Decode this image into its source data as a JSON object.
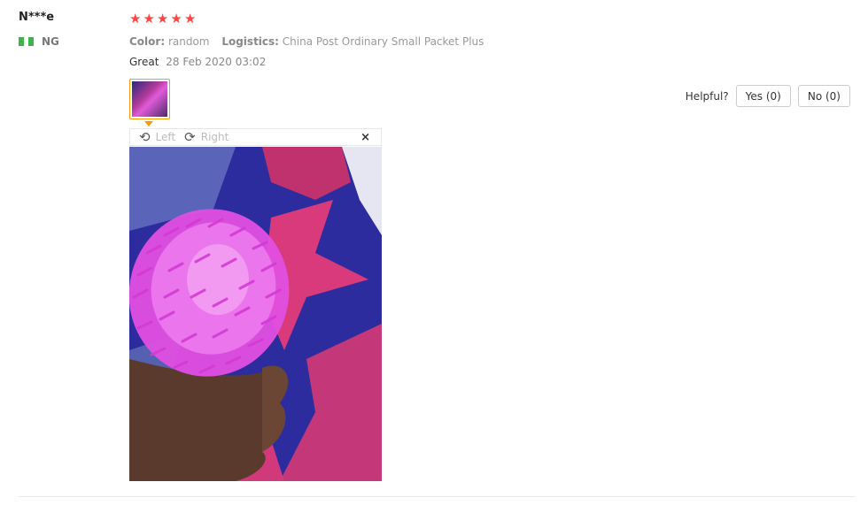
{
  "reviewer": {
    "name": "N***e",
    "country_code": "NG"
  },
  "colors": {
    "star": "#ff4747",
    "flag_green": "#3cb44b",
    "accent": "#ff9900"
  },
  "rating": {
    "stars": 5,
    "max": 5
  },
  "meta": {
    "color_label": "Color:",
    "color_value": "random",
    "logistics_label": "Logistics:",
    "logistics_value": "China Post Ordinary Small Packet Plus"
  },
  "comment": {
    "text": "Great",
    "date": "28 Feb 2020 03:02"
  },
  "viewer": {
    "rotate_left": "Left",
    "rotate_right": "Right",
    "close": "×"
  },
  "helpful": {
    "label": "Helpful?",
    "yes": "Yes (0)",
    "no": "No (0)"
  }
}
